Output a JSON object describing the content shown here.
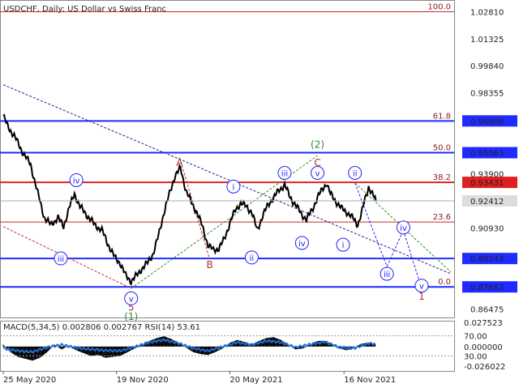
{
  "title_text": "USDCHF, Daily:  US Dollar vs Swiss Franc",
  "colors": {
    "background": "#ffffff",
    "price": "#000000",
    "axis_label_bg": "#1f3dff",
    "red_label_bg": "#e02020",
    "fib_line": "#c62828",
    "blue_line": "#1f2bff",
    "wave_red": "#b03030",
    "wave_green": "#2e8b2e",
    "wave_blue": "#2020ff",
    "macd_hist": "#000000",
    "macd_signal": "#1e6fd9"
  },
  "chart_data": [
    {
      "type": "line",
      "panel": "price",
      "symbol": "USDCHF",
      "timeframe": "Daily",
      "description": "US Dollar vs Swiss Franc",
      "ylim": [
        0.86,
        1.0328
      ],
      "y_ticks": [
        "1.02810",
        "1.01325",
        "0.99840",
        "0.98355",
        "0.95060",
        "0.93900",
        "0.92412",
        "0.90930",
        "0.89243",
        "0.86475"
      ],
      "y_tick_values": [
        1.0281,
        1.01325,
        0.9984,
        0.98355,
        0.9506,
        0.939,
        0.92412,
        0.9093,
        0.89243,
        0.86475
      ],
      "x_ticks": [
        "25 May 2020",
        "19 Nov 2020",
        "20 May 2021",
        "16 Nov 2021"
      ],
      "x_tick_index": [
        0,
        124,
        248,
        373
      ],
      "n_bars": 410,
      "close": [
        [
          0,
          0.9708
        ],
        [
          5,
          0.965
        ],
        [
          12,
          0.96
        ],
        [
          20,
          0.952
        ],
        [
          30,
          0.944
        ],
        [
          38,
          0.928
        ],
        [
          45,
          0.915
        ],
        [
          52,
          0.911
        ],
        [
          60,
          0.915
        ],
        [
          66,
          0.91
        ],
        [
          72,
          0.92
        ],
        [
          78,
          0.928
        ],
        [
          84,
          0.921
        ],
        [
          92,
          0.916
        ],
        [
          100,
          0.911
        ],
        [
          108,
          0.908
        ],
        [
          115,
          0.9
        ],
        [
          122,
          0.893
        ],
        [
          128,
          0.89
        ],
        [
          134,
          0.883
        ],
        [
          140,
          0.88
        ],
        [
          146,
          0.883
        ],
        [
          152,
          0.887
        ],
        [
          158,
          0.89
        ],
        [
          164,
          0.895
        ],
        [
          170,
          0.905
        ],
        [
          176,
          0.918
        ],
        [
          182,
          0.928
        ],
        [
          188,
          0.938
        ],
        [
          194,
          0.942
        ],
        [
          200,
          0.93
        ],
        [
          206,
          0.923
        ],
        [
          212,
          0.918
        ],
        [
          218,
          0.91
        ],
        [
          224,
          0.9
        ],
        [
          230,
          0.897
        ],
        [
          236,
          0.898
        ],
        [
          242,
          0.903
        ],
        [
          248,
          0.912
        ],
        [
          254,
          0.919
        ],
        [
          260,
          0.923
        ],
        [
          266,
          0.921
        ],
        [
          272,
          0.918
        ],
        [
          278,
          0.908
        ],
        [
          284,
          0.916
        ],
        [
          290,
          0.922
        ],
        [
          296,
          0.926
        ],
        [
          302,
          0.93
        ],
        [
          308,
          0.933
        ],
        [
          314,
          0.926
        ],
        [
          320,
          0.922
        ],
        [
          326,
          0.917
        ],
        [
          332,
          0.914
        ],
        [
          338,
          0.919
        ],
        [
          344,
          0.926
        ],
        [
          350,
          0.931
        ],
        [
          354,
          0.934
        ],
        [
          358,
          0.928
        ],
        [
          364,
          0.924
        ],
        [
          370,
          0.92
        ],
        [
          376,
          0.918
        ],
        [
          382,
          0.915
        ],
        [
          388,
          0.911
        ],
        [
          392,
          0.917
        ],
        [
          396,
          0.925
        ],
        [
          400,
          0.932
        ],
        [
          404,
          0.928
        ],
        [
          408,
          0.9241
        ]
      ],
      "horizontal_levels": [
        {
          "value": 0.96808,
          "label": "0.96808",
          "style": "blue",
          "fib": "61.8"
        },
        {
          "value": 0.95063,
          "label": "0.95063",
          "style": "blue",
          "fib": "50.0"
        },
        {
          "value": 0.93431,
          "label": "0.93431",
          "style": "red",
          "fib": "38.2"
        },
        {
          "value": 0.9125,
          "label": "",
          "style": "fib",
          "fib": "23.6"
        },
        {
          "value": 0.89243,
          "label": "0.89243",
          "style": "blue",
          "fib": ""
        },
        {
          "value": 0.87682,
          "label": "0.87682",
          "style": "blue",
          "fib": "0.0"
        },
        {
          "value": 1.0281,
          "label": "",
          "style": "fib",
          "fib": "100.0"
        }
      ],
      "current_price": "0.92412",
      "wave_labels": [
        {
          "text": "A",
          "x": 193,
          "y": 0.945,
          "color": "red",
          "circled": false
        },
        {
          "text": "B",
          "x": 226,
          "y": 0.889,
          "color": "red",
          "circled": false
        },
        {
          "text": "C",
          "x": 344,
          "y": 0.945,
          "color": "red",
          "circled": false
        },
        {
          "text": "(2)",
          "x": 344,
          "y": 0.955,
          "color": "green",
          "circled": false
        },
        {
          "text": "5",
          "x": 140,
          "y": 0.8655,
          "color": "red",
          "circled": false
        },
        {
          "text": "(1)",
          "x": 140,
          "y": 0.8605,
          "color": "green",
          "circled": false
        },
        {
          "text": "1",
          "x": 458,
          "y": 0.8715,
          "color": "red",
          "circled": false
        },
        {
          "text": "iv",
          "x": 80,
          "y": 0.9355,
          "color": "blue",
          "circled": true
        },
        {
          "text": "iii",
          "x": 63,
          "y": 0.8925,
          "color": "blue",
          "circled": true
        },
        {
          "text": "v",
          "x": 140,
          "y": 0.8705,
          "color": "blue",
          "circled": true
        },
        {
          "text": "i",
          "x": 252,
          "y": 0.932,
          "color": "blue",
          "circled": true
        },
        {
          "text": "ii",
          "x": 272,
          "y": 0.893,
          "color": "blue",
          "circled": true
        },
        {
          "text": "iii",
          "x": 308,
          "y": 0.9395,
          "color": "blue",
          "circled": true
        },
        {
          "text": "iv",
          "x": 327,
          "y": 0.901,
          "color": "blue",
          "circled": true
        },
        {
          "text": "v",
          "x": 344,
          "y": 0.9395,
          "color": "blue",
          "circled": true
        },
        {
          "text": "i",
          "x": 372,
          "y": 0.9,
          "color": "blue",
          "circled": true
        },
        {
          "text": "ii",
          "x": 385,
          "y": 0.9395,
          "color": "blue",
          "circled": true
        },
        {
          "text": "iv",
          "x": 438,
          "y": 0.9095,
          "color": "blue",
          "circled": true
        },
        {
          "text": "iii",
          "x": 420,
          "y": 0.884,
          "color": "blue",
          "circled": true
        },
        {
          "text": "v",
          "x": 458,
          "y": 0.8775,
          "color": "blue",
          "circled": true
        }
      ],
      "trendlines": [
        {
          "from": [
            0,
            0.988
          ],
          "to": [
            490,
            0.884
          ],
          "color": "navy",
          "dash": true
        },
        {
          "from": [
            140,
            0.876
          ],
          "to": [
            344,
            0.949
          ],
          "color": "green",
          "dash": true
        },
        {
          "from": [
            0,
            0.91
          ],
          "to": [
            140,
            0.876
          ],
          "color": "red",
          "dash": true
        },
        {
          "from": [
            193,
            0.948
          ],
          "to": [
            226,
            0.892
          ],
          "color": "red",
          "dash": true
        },
        {
          "from": [
            385,
            0.934
          ],
          "to": [
            420,
            0.888
          ],
          "color": "blue",
          "dash": true
        },
        {
          "from": [
            420,
            0.888
          ],
          "to": [
            438,
            0.908
          ],
          "color": "blue",
          "dash": true
        },
        {
          "from": [
            438,
            0.908
          ],
          "to": [
            458,
            0.876
          ],
          "color": "blue",
          "dash": true
        },
        {
          "from": [
            385,
            0.934
          ],
          "to": [
            490,
            0.885
          ],
          "color": "green",
          "dash": true
        }
      ]
    },
    {
      "type": "area",
      "panel": "indicator",
      "title": "MACD(5,34,5) 0.002806 0.002767 RSI(14) 53.61",
      "ylim": [
        -0.026022,
        0.027523
      ],
      "y_ticks": [
        "0.027523",
        "70.00",
        "0.000000",
        "30.00",
        "-0.026022"
      ],
      "macd_hist": [
        [
          0,
          0.002
        ],
        [
          8,
          -0.006
        ],
        [
          16,
          -0.011
        ],
        [
          24,
          -0.013
        ],
        [
          32,
          -0.015
        ],
        [
          40,
          -0.012
        ],
        [
          48,
          -0.006
        ],
        [
          56,
          0.002
        ],
        [
          64,
          -0.003
        ],
        [
          72,
          0.001
        ],
        [
          80,
          -0.004
        ],
        [
          88,
          -0.007
        ],
        [
          96,
          -0.01
        ],
        [
          104,
          -0.009
        ],
        [
          112,
          -0.012
        ],
        [
          120,
          -0.011
        ],
        [
          128,
          -0.01
        ],
        [
          136,
          -0.006
        ],
        [
          144,
          -0.002
        ],
        [
          152,
          0.002
        ],
        [
          160,
          0.006
        ],
        [
          168,
          0.009
        ],
        [
          176,
          0.011
        ],
        [
          184,
          0.008
        ],
        [
          192,
          0.004
        ],
        [
          200,
          -0.001
        ],
        [
          208,
          -0.006
        ],
        [
          216,
          -0.008
        ],
        [
          224,
          -0.009
        ],
        [
          232,
          -0.006
        ],
        [
          240,
          -0.002
        ],
        [
          248,
          0.004
        ],
        [
          256,
          0.007
        ],
        [
          264,
          0.005
        ],
        [
          272,
          0.002
        ],
        [
          280,
          0.006
        ],
        [
          288,
          0.009
        ],
        [
          296,
          0.01
        ],
        [
          304,
          0.007
        ],
        [
          312,
          0.002
        ],
        [
          320,
          -0.003
        ],
        [
          328,
          -0.002
        ],
        [
          336,
          0.002
        ],
        [
          344,
          0.006
        ],
        [
          352,
          0.006
        ],
        [
          360,
          0.003
        ],
        [
          368,
          -0.002
        ],
        [
          376,
          -0.004
        ],
        [
          384,
          -0.001
        ],
        [
          392,
          0.003
        ],
        [
          400,
          0.004
        ],
        [
          408,
          0.0028
        ]
      ],
      "rsi": [
        [
          0,
          45
        ],
        [
          16,
          40
        ],
        [
          32,
          38
        ],
        [
          48,
          47
        ],
        [
          64,
          52
        ],
        [
          80,
          46
        ],
        [
          96,
          43
        ],
        [
          112,
          41
        ],
        [
          128,
          40
        ],
        [
          144,
          48
        ],
        [
          160,
          57
        ],
        [
          176,
          62
        ],
        [
          192,
          55
        ],
        [
          208,
          45
        ],
        [
          224,
          40
        ],
        [
          240,
          48
        ],
        [
          256,
          57
        ],
        [
          272,
          52
        ],
        [
          288,
          60
        ],
        [
          304,
          57
        ],
        [
          320,
          47
        ],
        [
          336,
          53
        ],
        [
          352,
          58
        ],
        [
          368,
          47
        ],
        [
          384,
          45
        ],
        [
          400,
          55
        ],
        [
          408,
          53.61
        ]
      ]
    }
  ]
}
